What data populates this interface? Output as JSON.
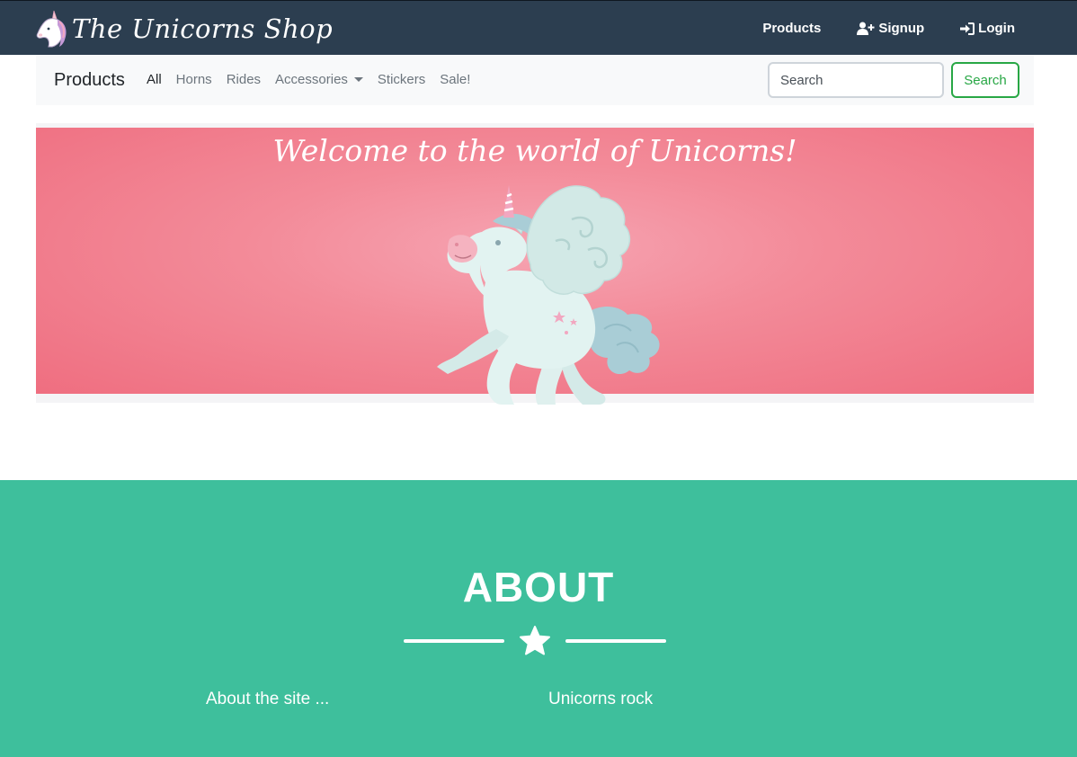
{
  "topbar": {
    "brand_text": "The Unicorns Shop",
    "logo_icon": "unicorn-head-logo",
    "nav": [
      {
        "label": "Products",
        "icon": ""
      },
      {
        "label": "Signup",
        "icon": "user-plus-icon"
      },
      {
        "label": "Login",
        "icon": "sign-in-icon"
      }
    ]
  },
  "subnav": {
    "brand": "Products",
    "items": [
      {
        "label": "All",
        "active": true
      },
      {
        "label": "Horns"
      },
      {
        "label": "Rides"
      },
      {
        "label": "Accessories",
        "dropdown": true
      },
      {
        "label": "Stickers"
      },
      {
        "label": "Sale!"
      }
    ],
    "search": {
      "placeholder": "Search",
      "button_label": "Search"
    }
  },
  "hero": {
    "title": "Welcome to the world of Unicorns!",
    "image_icon": "winged-unicorn-illustration"
  },
  "about": {
    "title": "ABOUT",
    "divider_icon": "star-icon",
    "left_text": "About the site ...",
    "right_text": "Unicorns rock"
  },
  "colors": {
    "topbar": "#2c3e50",
    "subbar": "#f8f9fa",
    "hero_pink": "#ef6e80",
    "about_green": "#3ebf9c",
    "search_green": "#28a745"
  }
}
